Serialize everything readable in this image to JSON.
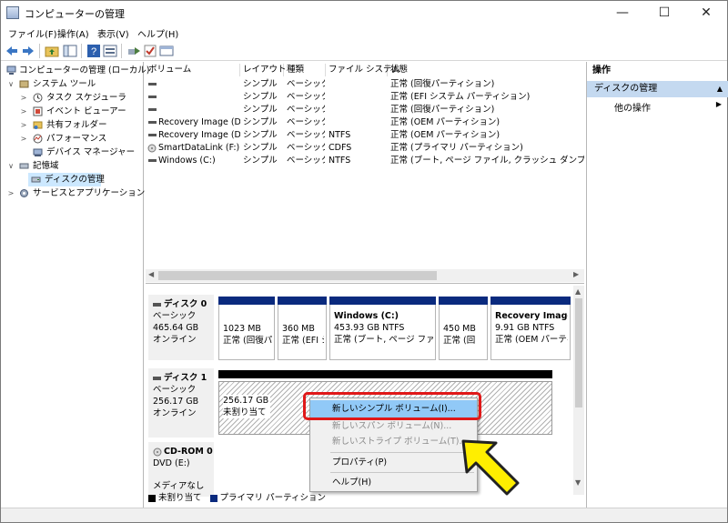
{
  "window": {
    "title": "コンピューターの管理",
    "minimize_glyph": "—",
    "maximize_glyph": "☐",
    "close_glyph": "✕"
  },
  "menu": [
    "ファイル(F)",
    "操作(A)",
    "表示(V)",
    "ヘルプ(H)"
  ],
  "toolbar_icons": [
    "back-arrow-icon",
    "forward-arrow-icon",
    "folder-up-icon",
    "console-tree-icon",
    "help-icon",
    "properties-icon",
    "export-icon",
    "checklist-icon",
    "window-icon"
  ],
  "tree": [
    {
      "label": "コンピューターの管理 (ローカル)",
      "level": 0,
      "twisty": "",
      "icon": "computer-icon"
    },
    {
      "label": "システム ツール",
      "level": 1,
      "twisty": "∨",
      "icon": "tools-icon"
    },
    {
      "label": "タスク スケジューラ",
      "level": 2,
      "twisty": ">",
      "icon": "clock-icon"
    },
    {
      "label": "イベント ビューアー",
      "level": 2,
      "twisty": ">",
      "icon": "event-viewer-icon"
    },
    {
      "label": "共有フォルダー",
      "level": 2,
      "twisty": ">",
      "icon": "shared-folder-icon"
    },
    {
      "label": "パフォーマンス",
      "level": 2,
      "twisty": ">",
      "icon": "performance-icon"
    },
    {
      "label": "デバイス マネージャー",
      "level": 2,
      "twisty": "",
      "icon": "device-manager-icon"
    },
    {
      "label": "記憶域",
      "level": 1,
      "twisty": "∨",
      "icon": "storage-icon"
    },
    {
      "label": "ディスクの管理",
      "level": 2,
      "twisty": "",
      "icon": "disk-icon",
      "selected": true
    },
    {
      "label": "サービスとアプリケーション",
      "level": 1,
      "twisty": ">",
      "icon": "services-icon"
    }
  ],
  "volume_columns": [
    "ボリューム",
    "レイアウト",
    "種類",
    "ファイル システム",
    "状態"
  ],
  "volumes": [
    {
      "name": "",
      "layout": "シンプル",
      "type": "ベーシック",
      "fs": "",
      "status": "正常 (回復パーティション)"
    },
    {
      "name": "",
      "layout": "シンプル",
      "type": "ベーシック",
      "fs": "",
      "status": "正常 (EFI システム パーティション)"
    },
    {
      "name": "",
      "layout": "シンプル",
      "type": "ベーシック",
      "fs": "",
      "status": "正常 (回復パーティション)"
    },
    {
      "name": "Recovery Image (D:)",
      "layout": "シンプル",
      "type": "ベーシック",
      "fs": "",
      "status": "正常 (OEM パーティション)"
    },
    {
      "name": "Recovery Image (D:)",
      "layout": "シンプル",
      "type": "ベーシック",
      "fs": "NTFS",
      "status": "正常 (OEM パーティション)"
    },
    {
      "name": "SmartDataLink (F:)",
      "layout": "シンプル",
      "type": "ベーシック",
      "fs": "CDFS",
      "status": "正常 (プライマリ パーティション)"
    },
    {
      "name": "Windows (C:)",
      "layout": "シンプル",
      "type": "ベーシック",
      "fs": "NTFS",
      "status": "正常 (ブート, ページ ファイル, クラッシュ ダンプ, プライマリ パ"
    }
  ],
  "disks": {
    "disk0": {
      "name": "ディスク 0",
      "type": "ベーシック",
      "size": "465.64 GB",
      "state": "オンライン",
      "partitions": [
        {
          "title": "",
          "size": "1023 MB",
          "desc": "正常 (回復パ"
        },
        {
          "title": "",
          "size": "360 MB",
          "desc": "正常 (EFI シ"
        },
        {
          "title": "Windows  (C:)",
          "size": "453.93 GB NTFS",
          "desc": "正常 (ブート, ページ ファイル, ク"
        },
        {
          "title": "",
          "size": "450 MB",
          "desc": "正常 (回"
        },
        {
          "title": "Recovery Image (",
          "size": "9.91 GB NTFS",
          "desc": "正常 (OEM パーティ"
        }
      ]
    },
    "disk1": {
      "name": "ディスク 1",
      "type": "ベーシック",
      "size": "256.17 GB",
      "state": "オンライン",
      "unalloc_size": "256.17 GB",
      "unalloc_label": "未割り当て"
    },
    "cdrom": {
      "name": "CD-ROM 0",
      "type": "DVD (E:)",
      "media": "メディアなし"
    }
  },
  "legend": {
    "unallocated": "未割り当て",
    "primary": "プライマリ パーティション",
    "unallocated_color": "#000000",
    "primary_color": "#0a2a7e"
  },
  "context_menu": {
    "new_simple": "新しいシンプル ボリューム(I)...",
    "new_spanned": "新しいスパン ボリューム(N)...",
    "new_striped": "新しいストライプ ボリューム(T)...",
    "properties": "プロパティ(P)",
    "help": "ヘルプ(H)"
  },
  "actions": {
    "header": "操作",
    "section": "ディスクの管理",
    "other": "他の操作"
  }
}
